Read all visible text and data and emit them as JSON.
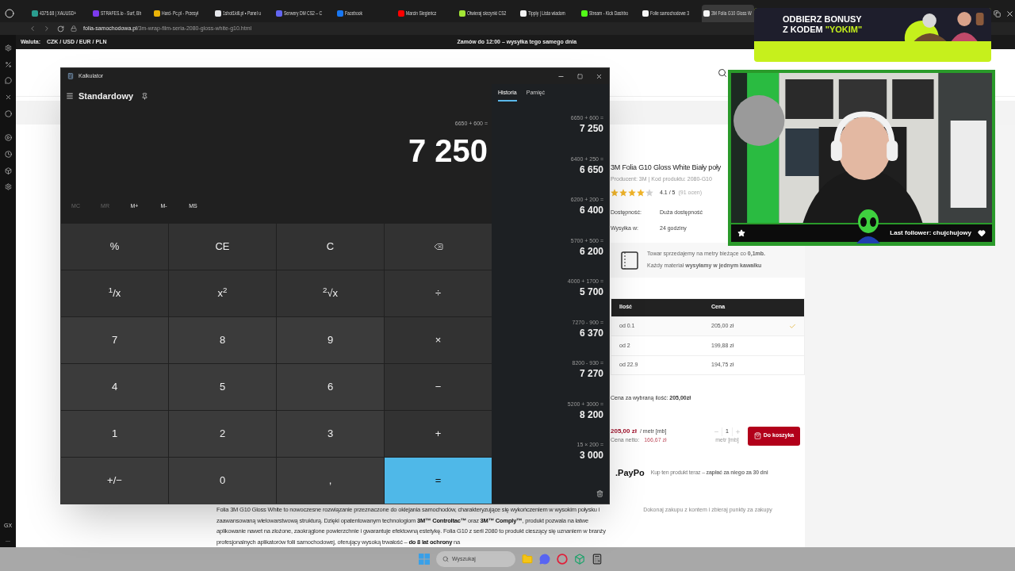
{
  "browser": {
    "tabs": [
      {
        "label": "4375.68 | XAUUSD+",
        "color": "#2a9d8f",
        "selected": false
      },
      {
        "label": "STRAFES.io - Surf, Bh",
        "color": "#7c3aed",
        "selected": false
      },
      {
        "label": "Hard- Pc.pl - Przesył",
        "color": "#eab308",
        "selected": false
      },
      {
        "label": "1shot1kill.pl • Panel u",
        "color": "#e5e7eb",
        "selected": false
      },
      {
        "label": "Serwery DM CS2 – C",
        "color": "#6366f1",
        "selected": false
      },
      {
        "label": "Facebook",
        "color": "#1877f2",
        "selected": false
      },
      {
        "label": "Marcin Siegieńcz",
        "color": "#ff0000",
        "selected": false
      },
      {
        "label": "Otwieraj skrzynki CS2",
        "color": "#a3e635",
        "selected": false
      },
      {
        "label": "Tipply | Lista wiadom",
        "color": "#f5f5f5",
        "selected": false
      },
      {
        "label": "Stream - Kick Dashbo",
        "color": "#53fc18",
        "selected": false
      },
      {
        "label": "Folie samochodowe 3",
        "color": "#f5f5f5",
        "selected": false
      },
      {
        "label": "3M Folia G10 Gloss W",
        "color": "#f5f5f5",
        "selected": true
      }
    ],
    "url": {
      "host": "folia-samochodowa.pl",
      "path": "/3m-wrap-film-seria-2080-gloss-white-g10.html"
    },
    "sidebar_footer": [
      "GX",
      "..."
    ]
  },
  "currency_bar": {
    "label": "Waluta:",
    "currencies": "CZK / USD / EUR / PLN",
    "promo": "Zamów do 12:00 – wysyłka tego samego dnia"
  },
  "product": {
    "title": "3M Folia G10 Gloss White Biały poły",
    "meta": "Producent: 3M | Kod produktu: 2080-G10",
    "stars": 4,
    "rating": "4.1 / 5",
    "reviews": "(91 ocen)",
    "specs": [
      {
        "label": "Dostępność:",
        "value": "Duża dostępność"
      },
      {
        "label": "Wysyłka w:",
        "value": "24 godziny"
      }
    ],
    "info_lines": [
      "Towar sprzedajemy na metry bieżące co **0,1mb.**",
      "Każdy materiał **wysyłamy w jednym kawałku**"
    ],
    "price_table": {
      "columns": [
        "Ilość",
        "Cena"
      ],
      "rows": [
        {
          "quantity": "od 0.1",
          "price": "205,00 zł",
          "selected": true
        },
        {
          "quantity": "od 2",
          "price": "199,88 zł",
          "selected": false
        },
        {
          "quantity": "od 22.9",
          "price": "194,75 zł",
          "selected": false
        }
      ]
    },
    "selected_total": "Cena za wybraną ilość: **205,00zł**",
    "price": "205,00 zł",
    "unit": "/ metr [mb]",
    "net_label": "Cena netto:",
    "net_price": "166,67 zł",
    "quantity": {
      "value": "1",
      "unit": "metr [mb]"
    },
    "add_to_cart": "Do koszyka",
    "paypo": {
      "logo": ".PayPo",
      "text": "Kup ten produkt teraz – **zapłać za niego za 30 dni**"
    },
    "points_note": "Dokonaj zakupu z kontem i zbieraj punkty za zakupy"
  },
  "description": "Folia 3M G10 Gloss White to nowoczesne rozwiązanie przeznaczone do oklejania samochodów, charakteryzujące się wykończeniem w wysokim połysku i zaawansowaną wielowarstwową strukturą. Dzięki opatentowanym technologiom **3M™ Controltac™** oraz **3M™ Comply™**, produkt pozwala na łatwe aplikowanie nawet na złożone, zaokrąglone powierzchnie i gwarantuje efektowną estetykę. Folia G10 z serii 2080 to produkt cieszący się uznaniem w branży profesjonalnych aplikatorów folii samochodowej, oferujący wysoką trwałość – **do 8 lat ochrony** na",
  "calculator": {
    "title": "Kalkulator",
    "mode": "Standardowy",
    "panel_tabs": [
      {
        "label": "Historia",
        "selected": true
      },
      {
        "label": "Pamięć",
        "selected": false
      }
    ],
    "expression": "6650 + 600 =",
    "display": "7 250",
    "memory_buttons": [
      {
        "label": "MC",
        "disabled": true
      },
      {
        "label": "MR",
        "disabled": true
      },
      {
        "label": "M+",
        "disabled": false
      },
      {
        "label": "M-",
        "disabled": false
      },
      {
        "label": "MS",
        "disabled": false
      }
    ],
    "keys": [
      {
        "label": "%",
        "kind": "op"
      },
      {
        "label": "CE",
        "kind": "op"
      },
      {
        "label": "C",
        "kind": "op"
      },
      {
        "kind": "backspace"
      },
      {
        "label": "$^{1}$/x",
        "kind": "op"
      },
      {
        "label": "x$^{2}$",
        "kind": "op"
      },
      {
        "label": "$^{2}$√x",
        "kind": "op"
      },
      {
        "label": "÷",
        "kind": "op"
      },
      {
        "label": "7",
        "kind": "num"
      },
      {
        "label": "8",
        "kind": "num"
      },
      {
        "label": "9",
        "kind": "num"
      },
      {
        "label": "×",
        "kind": "op"
      },
      {
        "label": "4",
        "kind": "num"
      },
      {
        "label": "5",
        "kind": "num"
      },
      {
        "label": "6",
        "kind": "num"
      },
      {
        "label": "−",
        "kind": "op"
      },
      {
        "label": "1",
        "kind": "num"
      },
      {
        "label": "2",
        "kind": "num"
      },
      {
        "label": "3",
        "kind": "num"
      },
      {
        "label": "+",
        "kind": "op"
      },
      {
        "label": "+/−",
        "kind": "num"
      },
      {
        "label": "0",
        "kind": "num"
      },
      {
        "label": ",",
        "kind": "num"
      },
      {
        "label": "=",
        "kind": "equals"
      }
    ],
    "history": [
      {
        "expression": "6650 + 600 =",
        "result": "7 250"
      },
      {
        "expression": "6400 + 250 =",
        "result": "6 650"
      },
      {
        "expression": "6200 + 200 =",
        "result": "6 400"
      },
      {
        "expression": "5700 + 500 =",
        "result": "6 200"
      },
      {
        "expression": "4000 + 1700 =",
        "result": "5 700"
      },
      {
        "expression": "7270 - 900 =",
        "result": "6 370"
      },
      {
        "expression": "8200 - 930 =",
        "result": "7 270"
      },
      {
        "expression": "5200 + 3000 =",
        "result": "8 200"
      },
      {
        "expression": "15 × 200 =",
        "result": "3 000"
      }
    ]
  },
  "stream_overlay": {
    "banner": {
      "line1": "ODBIERZ BONUSY",
      "line2": "Z KODEM",
      "code": "\"YOKIM\""
    },
    "follower": "Last follower: chujchujowy"
  },
  "taskbar": {
    "search_placeholder": "Wyszukaj"
  }
}
